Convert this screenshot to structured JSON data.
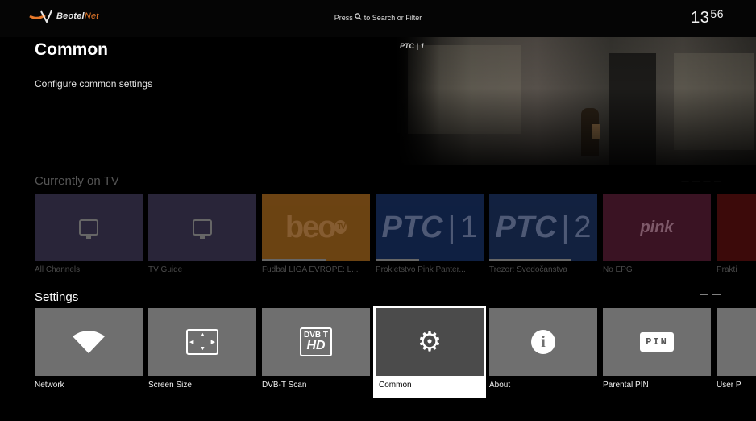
{
  "header": {
    "logo_primary": "Beotel",
    "logo_accent": "Net",
    "search_hint_prefix": "Press",
    "search_hint_suffix": "to Search or Filter",
    "clock_hour": "13",
    "clock_min": "56"
  },
  "page": {
    "title": "Common",
    "description": "Configure common settings"
  },
  "preview": {
    "channel_logo": "PTC | 1"
  },
  "currently_on_tv": {
    "label": "Currently on TV",
    "dots": "— — — —",
    "items": [
      {
        "caption": "All Channels",
        "tile_text": ""
      },
      {
        "caption": "TV Guide",
        "tile_text": ""
      },
      {
        "caption": "Fudbal LIGA EVROPE: L...",
        "tile_text": "beo",
        "badge": "TV"
      },
      {
        "caption": "Prokletstvo Pink Panter...",
        "tile_text": "PTC",
        "suffix": "1"
      },
      {
        "caption": "Trezor: Svedočanstva",
        "tile_text": "PTC",
        "suffix": "2"
      },
      {
        "caption": "No EPG",
        "tile_text": "pink"
      },
      {
        "caption": "Prakti",
        "tile_text": ""
      }
    ]
  },
  "settings": {
    "label": "Settings",
    "dots": "— —",
    "items": [
      {
        "caption": "Network",
        "icon": "wifi-icon"
      },
      {
        "caption": "Screen Size",
        "icon": "screen-size-icon"
      },
      {
        "caption": "DVB-T Scan",
        "icon": "dvb-hd-icon",
        "icon_top": "DVB T",
        "icon_bottom": "HD"
      },
      {
        "caption": "Common",
        "icon": "gear-icon"
      },
      {
        "caption": "About",
        "icon": "info-icon",
        "icon_text": "i"
      },
      {
        "caption": "Parental PIN",
        "icon": "pin-icon",
        "icon_text": "PIN"
      },
      {
        "caption": "User P",
        "icon": ""
      }
    ],
    "focused_index": 3
  },
  "colors": {
    "background": "#000000",
    "tile_gray": "#6f6f6f",
    "focus_outline": "#ffffff",
    "accent_orange": "#e8792a"
  }
}
